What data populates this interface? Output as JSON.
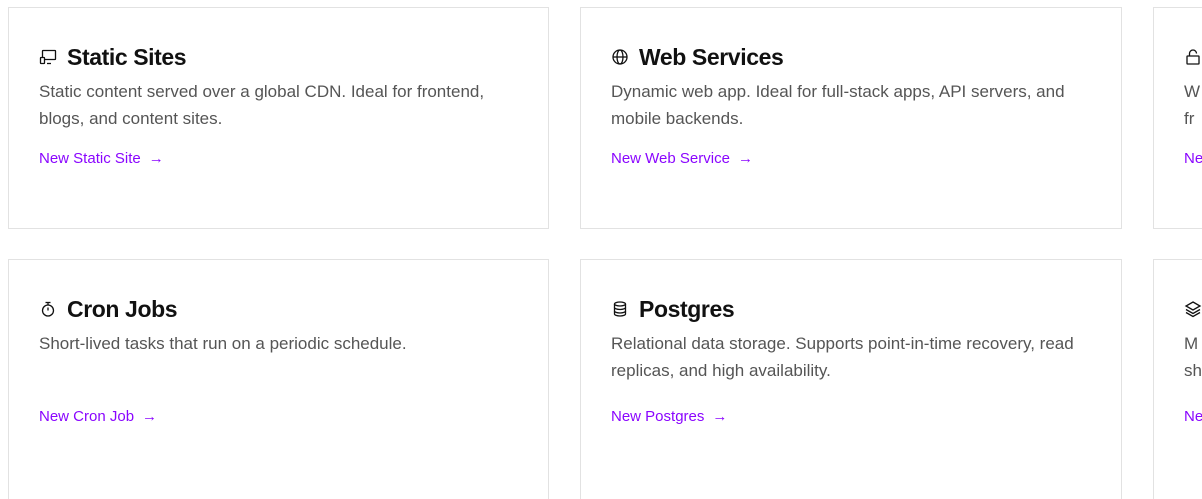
{
  "cards": [
    {
      "title": "Static Sites",
      "icon": "static-site-icon",
      "description": "Static content served over a global CDN. Ideal for frontend, blogs, and content sites.",
      "link_label": "New Static Site"
    },
    {
      "title": "Web Services",
      "icon": "globe-icon",
      "description": "Dynamic web app. Ideal for full-stack apps, API servers, and mobile backends.",
      "link_label": "New Web Service"
    },
    {
      "title": "",
      "icon": "lock-icon",
      "description_line1": "W",
      "description_line2": "fr",
      "link_label": "Ne"
    },
    {
      "title": "Cron Jobs",
      "icon": "stopwatch-icon",
      "description": "Short-lived tasks that run on a periodic schedule.",
      "link_label": "New Cron Job"
    },
    {
      "title": "Postgres",
      "icon": "database-icon",
      "description": "Relational data storage. Supports point-in-time recovery, read replicas, and high availability.",
      "link_label": "New Postgres"
    },
    {
      "title": "",
      "icon": "layers-icon",
      "description_line1": "M",
      "description_line2": "sh",
      "link_label": "Ne"
    }
  ],
  "arrow_glyph": "→",
  "colors": {
    "link": "#8a05ff",
    "border": "#e2e2e2",
    "title": "#111111",
    "description": "#555555"
  }
}
